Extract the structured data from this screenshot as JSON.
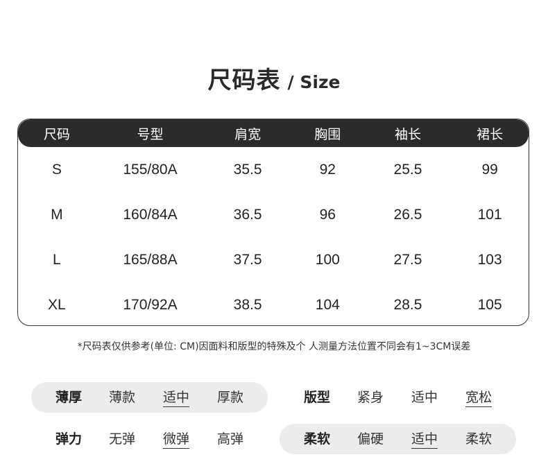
{
  "title": {
    "main": "尺码表",
    "sub": "/ Size"
  },
  "table": {
    "headers": [
      "尺码",
      "号型",
      "肩宽",
      "胸围",
      "袖长",
      "裙长"
    ],
    "rows": [
      [
        "S",
        "155/80A",
        "35.5",
        "92",
        "25.5",
        "99"
      ],
      [
        "M",
        "160/84A",
        "36.5",
        "96",
        "26.5",
        "101"
      ],
      [
        "L",
        "165/88A",
        "37.5",
        "100",
        "27.5",
        "103"
      ],
      [
        "XL",
        "170/92A",
        "38.5",
        "104",
        "28.5",
        "105"
      ]
    ]
  },
  "note": "*尺码表仅供参考(单位: CM)因面料和版型的特殊及个 人测量方法位置不同会有1~3CM误差",
  "attributes": {
    "thickness": {
      "label": "薄厚",
      "options": [
        "薄款",
        "适中",
        "厚款"
      ],
      "selected": "适中"
    },
    "fit": {
      "label": "版型",
      "options": [
        "紧身",
        "适中",
        "宽松"
      ],
      "selected": "宽松"
    },
    "elasticity": {
      "label": "弹力",
      "options": [
        "无弹",
        "微弹",
        "高弹"
      ],
      "selected": "微弹"
    },
    "softness": {
      "label": "柔软",
      "options": [
        "偏硬",
        "适中",
        "柔软"
      ],
      "selected": "适中"
    }
  }
}
